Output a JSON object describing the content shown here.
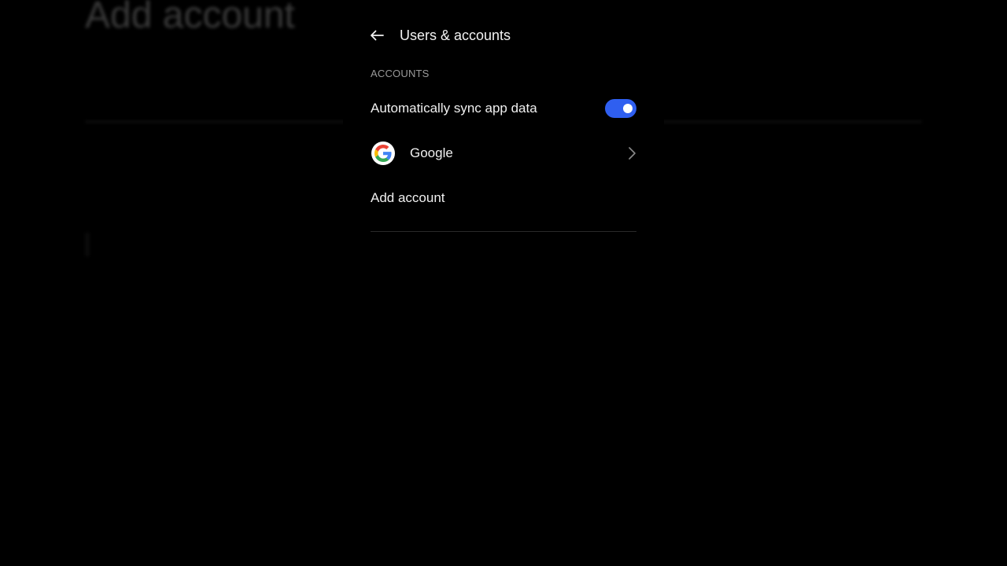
{
  "background": {
    "title": "Add account"
  },
  "header": {
    "back_icon": "arrow-left-icon",
    "title": "Users & accounts"
  },
  "accounts_section": {
    "label": "ACCOUNTS",
    "auto_sync": {
      "label": "Automatically sync app data",
      "enabled": true,
      "toggle_color": "#2f5ff0"
    },
    "accounts": [
      {
        "label": "Google",
        "icon": "google-logo-icon",
        "chevron_icon": "chevron-right-icon"
      }
    ],
    "add_account_label": "Add account"
  }
}
